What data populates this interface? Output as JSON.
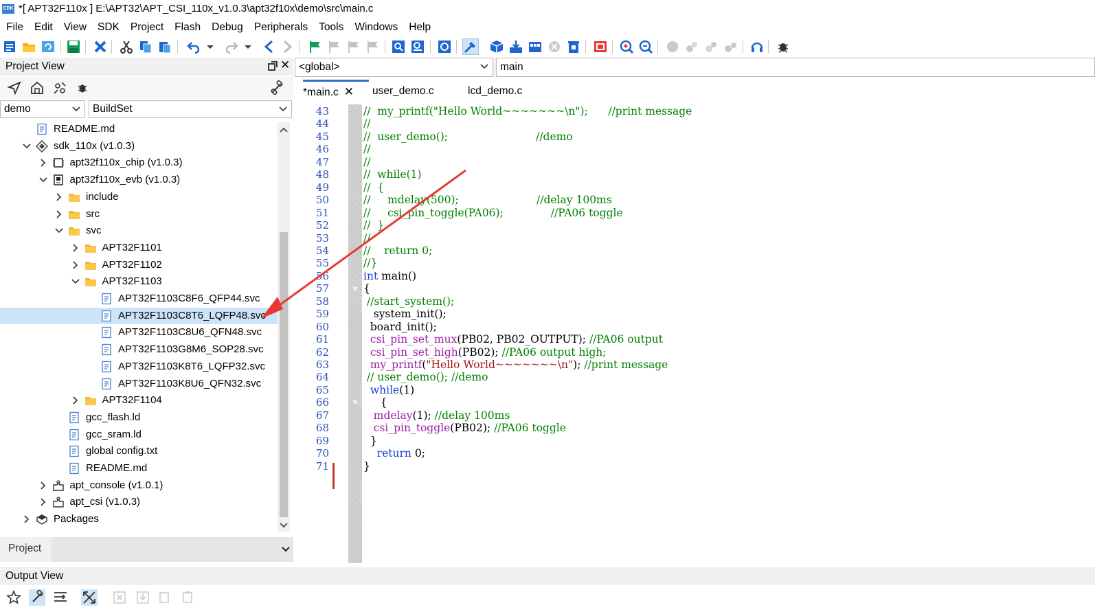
{
  "window": {
    "title": "*[ APT32F110x ] E:\\APT32\\APT_CSI_110x_v1.0.3\\apt32f10x\\demo\\src\\main.c",
    "app_icon_text": "CDK"
  },
  "menu": [
    "File",
    "Edit",
    "View",
    "SDK",
    "Project",
    "Flash",
    "Debug",
    "Peripherals",
    "Tools",
    "Windows",
    "Help"
  ],
  "project_view": {
    "title": "Project View",
    "project_select": "demo",
    "build_select": "BuildSet",
    "tree": [
      {
        "label": "README.md",
        "icon": "file-icon",
        "expander": "none"
      },
      {
        "label": "sdk_110x (v1.0.3)",
        "icon": "sdk-icon",
        "expander": "expanded"
      },
      {
        "label": "apt32f110x_chip (v1.0.3)",
        "icon": "chip-icon",
        "expander": "collapsed"
      },
      {
        "label": "apt32f110x_evb (v1.0.3)",
        "icon": "board-icon",
        "expander": "expanded"
      },
      {
        "label": "include",
        "icon": "folder-icon",
        "expander": "collapsed"
      },
      {
        "label": "src",
        "icon": "folder-icon",
        "expander": "collapsed"
      },
      {
        "label": "svc",
        "icon": "folder-icon",
        "expander": "expanded"
      },
      {
        "label": "APT32F1101",
        "icon": "folder-icon",
        "expander": "collapsed"
      },
      {
        "label": "APT32F1102",
        "icon": "folder-icon",
        "expander": "collapsed"
      },
      {
        "label": "APT32F1103",
        "icon": "folder-icon",
        "expander": "expanded"
      },
      {
        "label": "APT32F1103C8F6_QFP44.svc",
        "icon": "file-icon",
        "expander": "none"
      },
      {
        "label": "APT32F1103C8T6_LQFP48.svc",
        "icon": "file-icon",
        "expander": "none",
        "selected": true
      },
      {
        "label": "APT32F1103C8U6_QFN48.svc",
        "icon": "file-icon",
        "expander": "none"
      },
      {
        "label": "APT32F1103G8M6_SOP28.svc",
        "icon": "file-icon",
        "expander": "none"
      },
      {
        "label": "APT32F1103K8T6_LQFP32.svc",
        "icon": "file-icon",
        "expander": "none"
      },
      {
        "label": "APT32F1103K8U6_QFN32.svc",
        "icon": "file-icon",
        "expander": "none"
      },
      {
        "label": "APT32F1104",
        "icon": "folder-icon",
        "expander": "collapsed"
      },
      {
        "label": "gcc_flash.ld",
        "icon": "file-icon",
        "expander": "none"
      },
      {
        "label": "gcc_sram.ld",
        "icon": "file-icon",
        "expander": "none"
      },
      {
        "label": "global config.txt",
        "icon": "file-icon",
        "expander": "none"
      },
      {
        "label": "README.md",
        "icon": "file-icon",
        "expander": "none"
      },
      {
        "label": "apt_console (v1.0.1)",
        "icon": "component-icon",
        "expander": "collapsed"
      },
      {
        "label": "apt_csi (v1.0.3)",
        "icon": "component-icon",
        "expander": "collapsed"
      },
      {
        "label": "Packages",
        "icon": "packages-icon",
        "expander": "collapsed"
      }
    ],
    "bottom_tab": "Project"
  },
  "editor": {
    "scope_select": "<global>",
    "symbol_field": "main",
    "tabs": [
      {
        "label": "*main.c",
        "active": true
      },
      {
        "label": "user_demo.c",
        "active": false
      },
      {
        "label": "lcd_demo.c",
        "active": false
      }
    ],
    "lines": [
      {
        "n": "43",
        "code": "//  my_printf(\"Hello World~~~~~~~\\n\");      //print message",
        "style": "cm"
      },
      {
        "n": "44",
        "code": "//",
        "style": "cm"
      },
      {
        "n": "45",
        "code": "//  user_demo();                          //demo",
        "style": "cm"
      },
      {
        "n": "46",
        "code": "//",
        "style": "cm"
      },
      {
        "n": "47",
        "code": "//",
        "style": "cm"
      },
      {
        "n": "48",
        "code": "//  while(1)",
        "style": "cm"
      },
      {
        "n": "49",
        "code": "//  {",
        "style": "cm"
      },
      {
        "n": "50",
        "code": "//     mdelay(500);                       //delay 100ms",
        "style": "cm"
      },
      {
        "n": "51",
        "code": "//     csi_pin_toggle(PA06);              //PA06 toggle",
        "style": "cm"
      },
      {
        "n": "52",
        "code": "//  }",
        "style": "cm"
      },
      {
        "n": "53",
        "code": "//",
        "style": "cm"
      },
      {
        "n": "54",
        "code": "//    return 0;",
        "style": "cm"
      },
      {
        "n": "55",
        "code": "//}",
        "style": "cm"
      },
      {
        "n": "56",
        "code": "int main()",
        "style": "main"
      },
      {
        "n": "57",
        "code": "{",
        "style": "plain"
      },
      {
        "n": "58",
        "code": " //start_system();",
        "style": "cm"
      },
      {
        "n": "59",
        "code": "   system_init();",
        "style": "plain"
      },
      {
        "n": "60",
        "code": "  board_init();",
        "style": "plain"
      },
      {
        "n": "61",
        "code": "  csi_pin_set_mux(PB02, PB02_OUTPUT); //PA06 output",
        "style": "call",
        "fn": "csi_pin_set_mux",
        "args": "(PB02, PB02_OUTPUT);",
        "cm": " //PA06 output"
      },
      {
        "n": "62",
        "code": "  csi_pin_set_high(PB02); //PA06 output high;",
        "style": "call",
        "fn": "csi_pin_set_high",
        "args": "(PB02);",
        "cm": " //PA06 output high;"
      },
      {
        "n": "63",
        "code": "  my_printf(\"Hello World~~~~~~~\\n\"); //print message",
        "style": "printf"
      },
      {
        "n": "64",
        "code": " // user_demo(); //demo",
        "style": "cm"
      },
      {
        "n": "65",
        "code": "  while(1)",
        "style": "while"
      },
      {
        "n": "66",
        "code": "     {",
        "style": "plain"
      },
      {
        "n": "67",
        "code": "   mdelay(1); //delay 100ms",
        "style": "call",
        "fn": "mdelay",
        "args": "(1);",
        "cm": " //delay 100ms"
      },
      {
        "n": "68",
        "code": "   csi_pin_toggle(PB02); //PA06 toggle",
        "style": "call",
        "fn": "csi_pin_toggle",
        "args": "(PB02);",
        "cm": " //PA06 toggle"
      },
      {
        "n": "69",
        "code": "  }",
        "style": "plain"
      },
      {
        "n": "70",
        "code": "    return 0;",
        "style": "return"
      },
      {
        "n": "71",
        "code": "}",
        "style": "plain"
      }
    ]
  },
  "output_view": {
    "title": "Output View"
  },
  "colors": {
    "comment": "#008000",
    "keyword": "#1a3fcf",
    "function": "#9b1fa8",
    "string": "#a31515",
    "line_number": "#2b4fb3",
    "selection": "#cde3f8",
    "annotation_arrow": "#e53935"
  }
}
